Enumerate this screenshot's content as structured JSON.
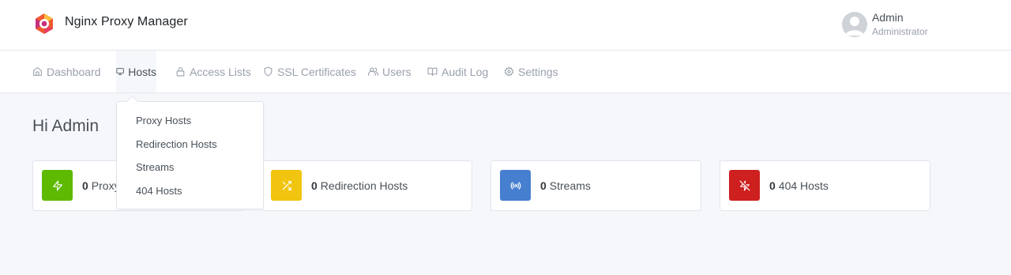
{
  "header": {
    "app_title": "Nginx Proxy Manager",
    "user_name": "Admin",
    "user_role": "Administrator"
  },
  "nav": {
    "items": [
      {
        "label": "Dashboard",
        "icon": "home-icon"
      },
      {
        "label": "Hosts",
        "icon": "monitor-icon",
        "active": true
      },
      {
        "label": "Access Lists",
        "icon": "lock-icon"
      },
      {
        "label": "SSL Certificates",
        "icon": "shield-icon"
      },
      {
        "label": "Users",
        "icon": "users-icon"
      },
      {
        "label": "Audit Log",
        "icon": "book-open-icon"
      },
      {
        "label": "Settings",
        "icon": "settings-icon"
      }
    ]
  },
  "hosts_menu": {
    "items": [
      "Proxy Hosts",
      "Redirection Hosts",
      "Streams",
      "404 Hosts"
    ]
  },
  "main": {
    "greeting": "Hi Admin",
    "cards": [
      {
        "count": "0",
        "label": "Proxy Hosts",
        "color": "#5eba00",
        "icon": "zap-icon"
      },
      {
        "count": "0",
        "label": "Redirection Hosts",
        "color": "#f1c40f",
        "icon": "shuffle-icon"
      },
      {
        "count": "0",
        "label": "Streams",
        "color": "#467fcf",
        "icon": "radio-icon"
      },
      {
        "count": "0",
        "label": "404 Hosts",
        "color": "#cd201f",
        "icon": "zap-off-icon"
      }
    ]
  },
  "colors": {
    "background": "#f5f7fb",
    "text": "#495057",
    "muted": "#9aa0ac"
  }
}
